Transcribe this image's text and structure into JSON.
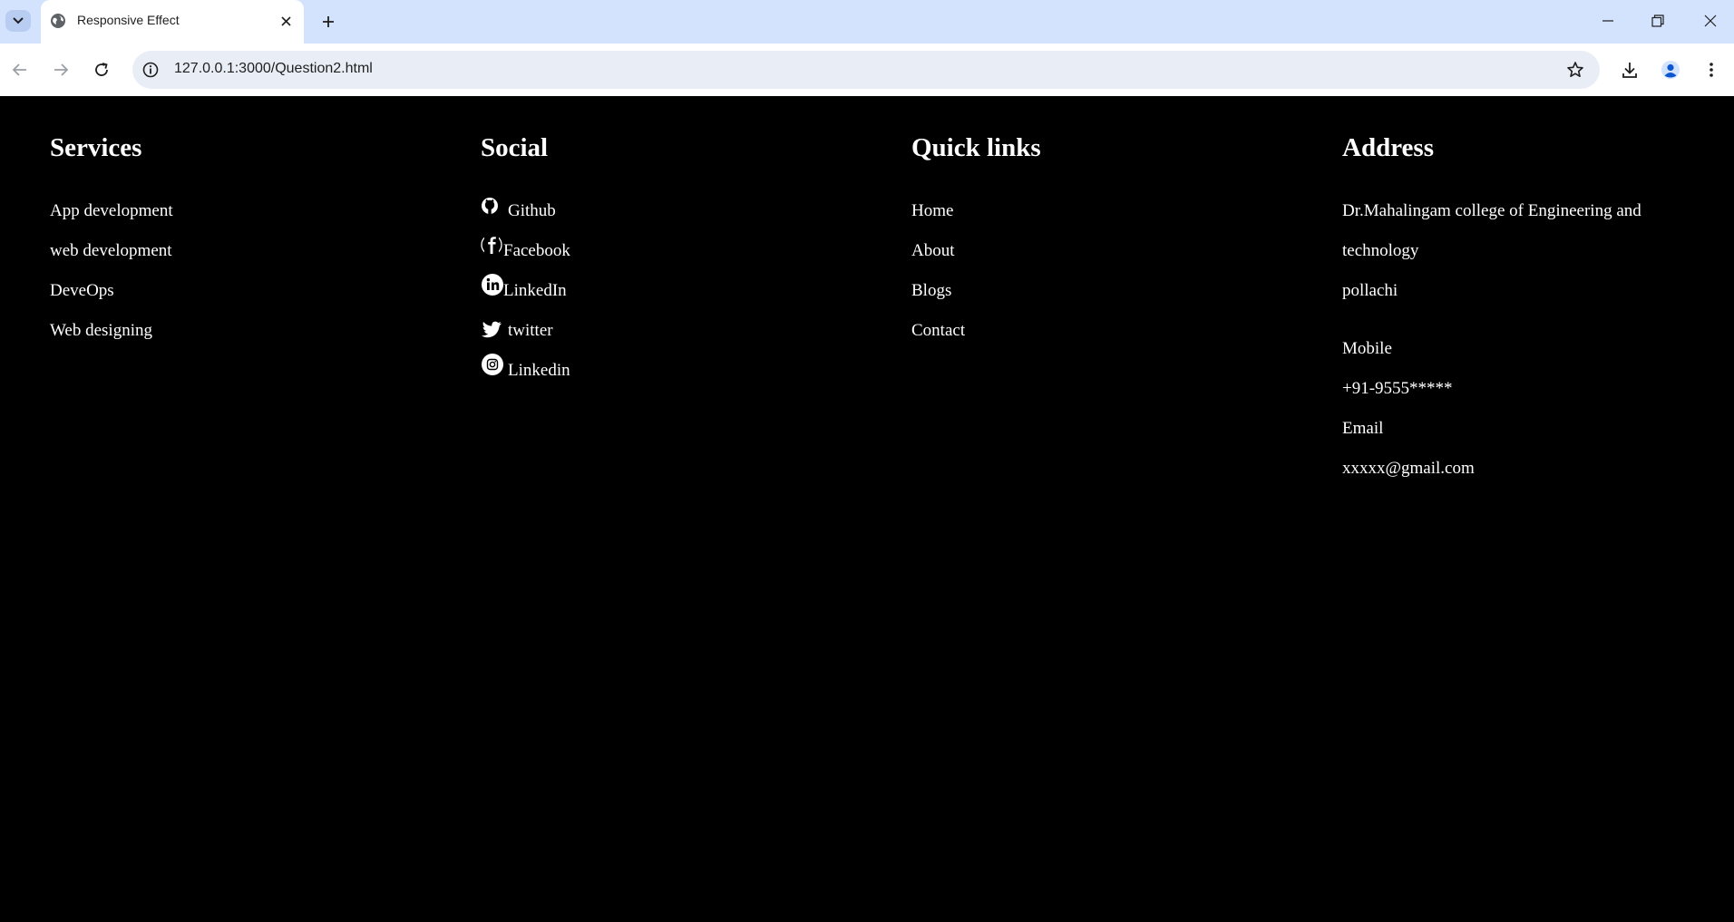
{
  "browser": {
    "tab_title": "Responsive Effect",
    "url": "127.0.0.1:3000/Question2.html"
  },
  "footer": {
    "services": {
      "heading": "Services",
      "items": [
        "App development",
        "web development",
        "DeveOps",
        "Web designing"
      ]
    },
    "social": {
      "heading": "Social",
      "items": [
        {
          "label": "Github",
          "icon": "github-icon"
        },
        {
          "label": "Facebook",
          "icon": "facebook-icon"
        },
        {
          "label": "LinkedIn",
          "icon": "linkedin-icon"
        },
        {
          "label": "twitter",
          "icon": "twitter-icon"
        },
        {
          "label": "Linkedin",
          "icon": "instagram-icon"
        }
      ]
    },
    "quick_links": {
      "heading": "Quick links",
      "items": [
        "Home",
        "About",
        "Blogs",
        "Contact"
      ]
    },
    "address": {
      "heading": "Address",
      "line1": "Dr.Mahalingam college of Engineering and",
      "line2": "technology",
      "line3": "pollachi",
      "mobile_label": "Mobile",
      "mobile_value": "+91-9555*****",
      "email_label": "Email",
      "email_value": "xxxxx@gmail.com"
    }
  },
  "colors": {
    "page_bg": "#000000",
    "text": "#ffffff",
    "tabbar_bg": "#d3e3fd",
    "omnibox_bg": "#e9eef6"
  }
}
